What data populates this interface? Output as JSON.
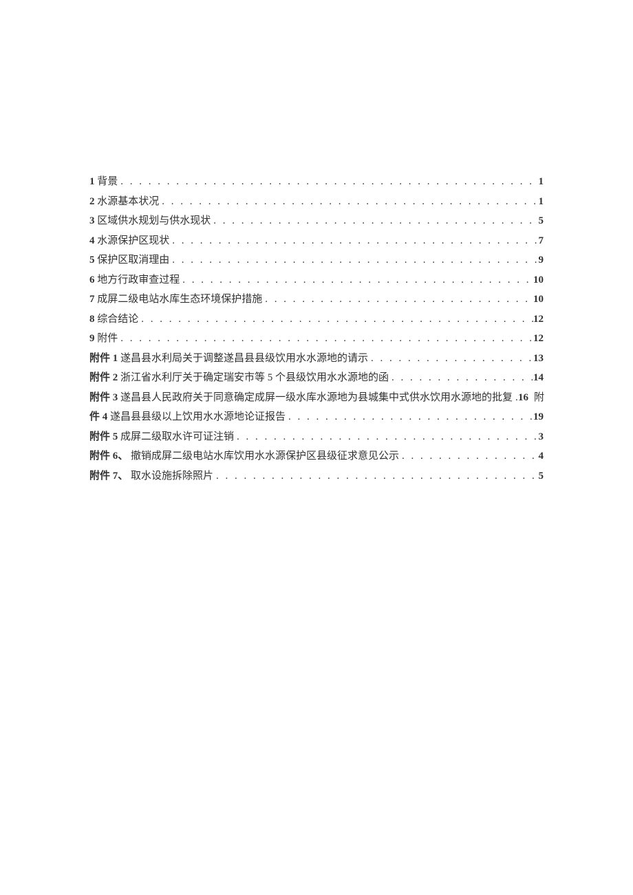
{
  "toc": [
    {
      "num": "1",
      "title": "背景",
      "page": "1"
    },
    {
      "num": "2",
      "title": "水源基本状况",
      "page": "1"
    },
    {
      "num": "3",
      "title": "区域供水规划与供水现状",
      "page": "5"
    },
    {
      "num": "4",
      "title": "水源保护区现状",
      "page": "7"
    },
    {
      "num": "5",
      "title": "保护区取消理由",
      "page": "9"
    },
    {
      "num": "6",
      "title": "地方行政审查过程",
      "page": "10"
    },
    {
      "num": "7",
      "title": "成屏二级电站水库生态环境保护措施",
      "page": "10"
    },
    {
      "num": "8",
      "title": "综合结论",
      "page": "12"
    },
    {
      "num": "9",
      "title": "附件",
      "page": "12"
    },
    {
      "num": "附件 1",
      "title": "遂昌县水利局关于调整遂昌县县级饮用水水源地的请示",
      "page": "13"
    },
    {
      "num": "附件 2",
      "title": "浙江省水利厅关于确定瑞安市等 5 个县级饮用水水源地的函",
      "page": "14"
    },
    {
      "num": "附件 3",
      "title": "遂昌县人民政府关于同意确定成屏一级水库水源地为县城集中式供水饮用水源地的批复",
      "page": "16",
      "trailing": "附"
    },
    {
      "num": "件 4",
      "title": "遂昌县县级以上饮用水水源地论证报告",
      "page": "19"
    },
    {
      "num": "附件 5",
      "title": "成屏二级取水许可证注销",
      "page": "3"
    },
    {
      "num": "附件 6、",
      "title": "撤销成屏二级电站水库饮用水水源保护区县级征求意见公示",
      "page": "4"
    },
    {
      "num": "附件 7、",
      "title": "取水设施拆除照片",
      "page": "5"
    }
  ]
}
